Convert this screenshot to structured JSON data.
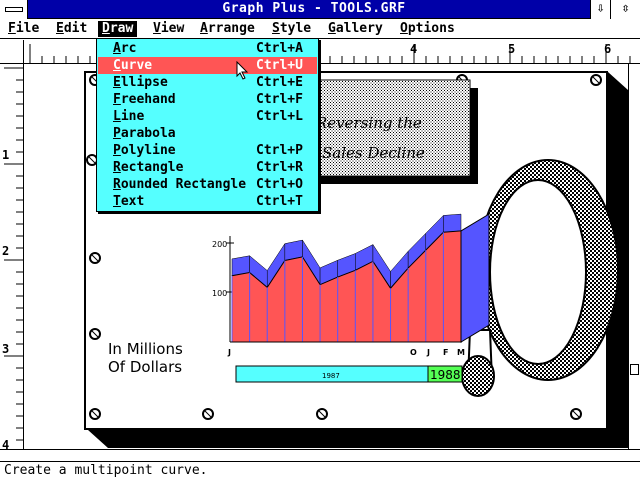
{
  "titlebar": {
    "title": "Graph Plus - TOOLS.GRF",
    "min_glyph": "⇩",
    "max_glyph": "⇳"
  },
  "menubar": {
    "items": [
      {
        "hot": "F",
        "rest": "ile"
      },
      {
        "hot": "E",
        "rest": "dit"
      },
      {
        "hot": "D",
        "rest": "raw"
      },
      {
        "hot": "V",
        "rest": "iew"
      },
      {
        "hot": "A",
        "rest": "rrange"
      },
      {
        "hot": "S",
        "rest": "tyle"
      },
      {
        "hot": "G",
        "rest": "allery"
      },
      {
        "hot": "O",
        "rest": "ptions"
      }
    ]
  },
  "draw_menu": {
    "items": [
      {
        "hot": "A",
        "rest": "rc",
        "accel": "Ctrl+A"
      },
      {
        "hot": "C",
        "rest": "urve",
        "accel": "Ctrl+U"
      },
      {
        "hot": "E",
        "rest": "llipse",
        "accel": "Ctrl+E"
      },
      {
        "hot": "F",
        "rest": "reehand",
        "accel": "Ctrl+F"
      },
      {
        "hot": "L",
        "rest": "ine",
        "accel": "Ctrl+L"
      },
      {
        "hot": "P",
        "rest": "arabola",
        "accel": ""
      },
      {
        "hot": "P",
        "rest": "olyline",
        "accel": "Ctrl+P"
      },
      {
        "hot": "R",
        "rest": "ectangle",
        "accel": "Ctrl+R"
      },
      {
        "hot": "R",
        "rest": "ounded Rectangle",
        "accel": "Ctrl+O"
      },
      {
        "hot": "T",
        "rest": "ext",
        "accel": "Ctrl+T"
      }
    ],
    "selected_index": 1
  },
  "rulers": {
    "horizontal": [
      "4",
      "5",
      "6"
    ],
    "vertical": [
      "1",
      "2",
      "3",
      "4"
    ]
  },
  "drawing": {
    "headline_line1": "Reversing the",
    "headline_line2": "Sales Decline",
    "y_ticks": [
      "200",
      "100"
    ],
    "month_labels": [
      "J",
      "O",
      "J",
      "F",
      "M"
    ],
    "units_line1": "In Millions",
    "units_line2": "Of Dollars",
    "year_1987": "1987",
    "year_1988": "1988"
  },
  "chart_data": {
    "type": "area",
    "x": [
      "J",
      "",
      "",
      "",
      "",
      "",
      "",
      "",
      "",
      "O",
      "",
      "J",
      "F",
      "M"
    ],
    "values": [
      148,
      155,
      122,
      182,
      190,
      128,
      145,
      160,
      180,
      120,
      165,
      205,
      245,
      248
    ],
    "ylim": [
      0,
      250
    ],
    "colors": {
      "front": "#ff5555",
      "top": "#5555ff"
    }
  },
  "status": {
    "text": "Create a multipoint curve."
  },
  "colors": {
    "title_bg": "#0000a8",
    "menu_bg": "#55ffff",
    "highlight": "#ff5555",
    "green": "#55ff55"
  }
}
